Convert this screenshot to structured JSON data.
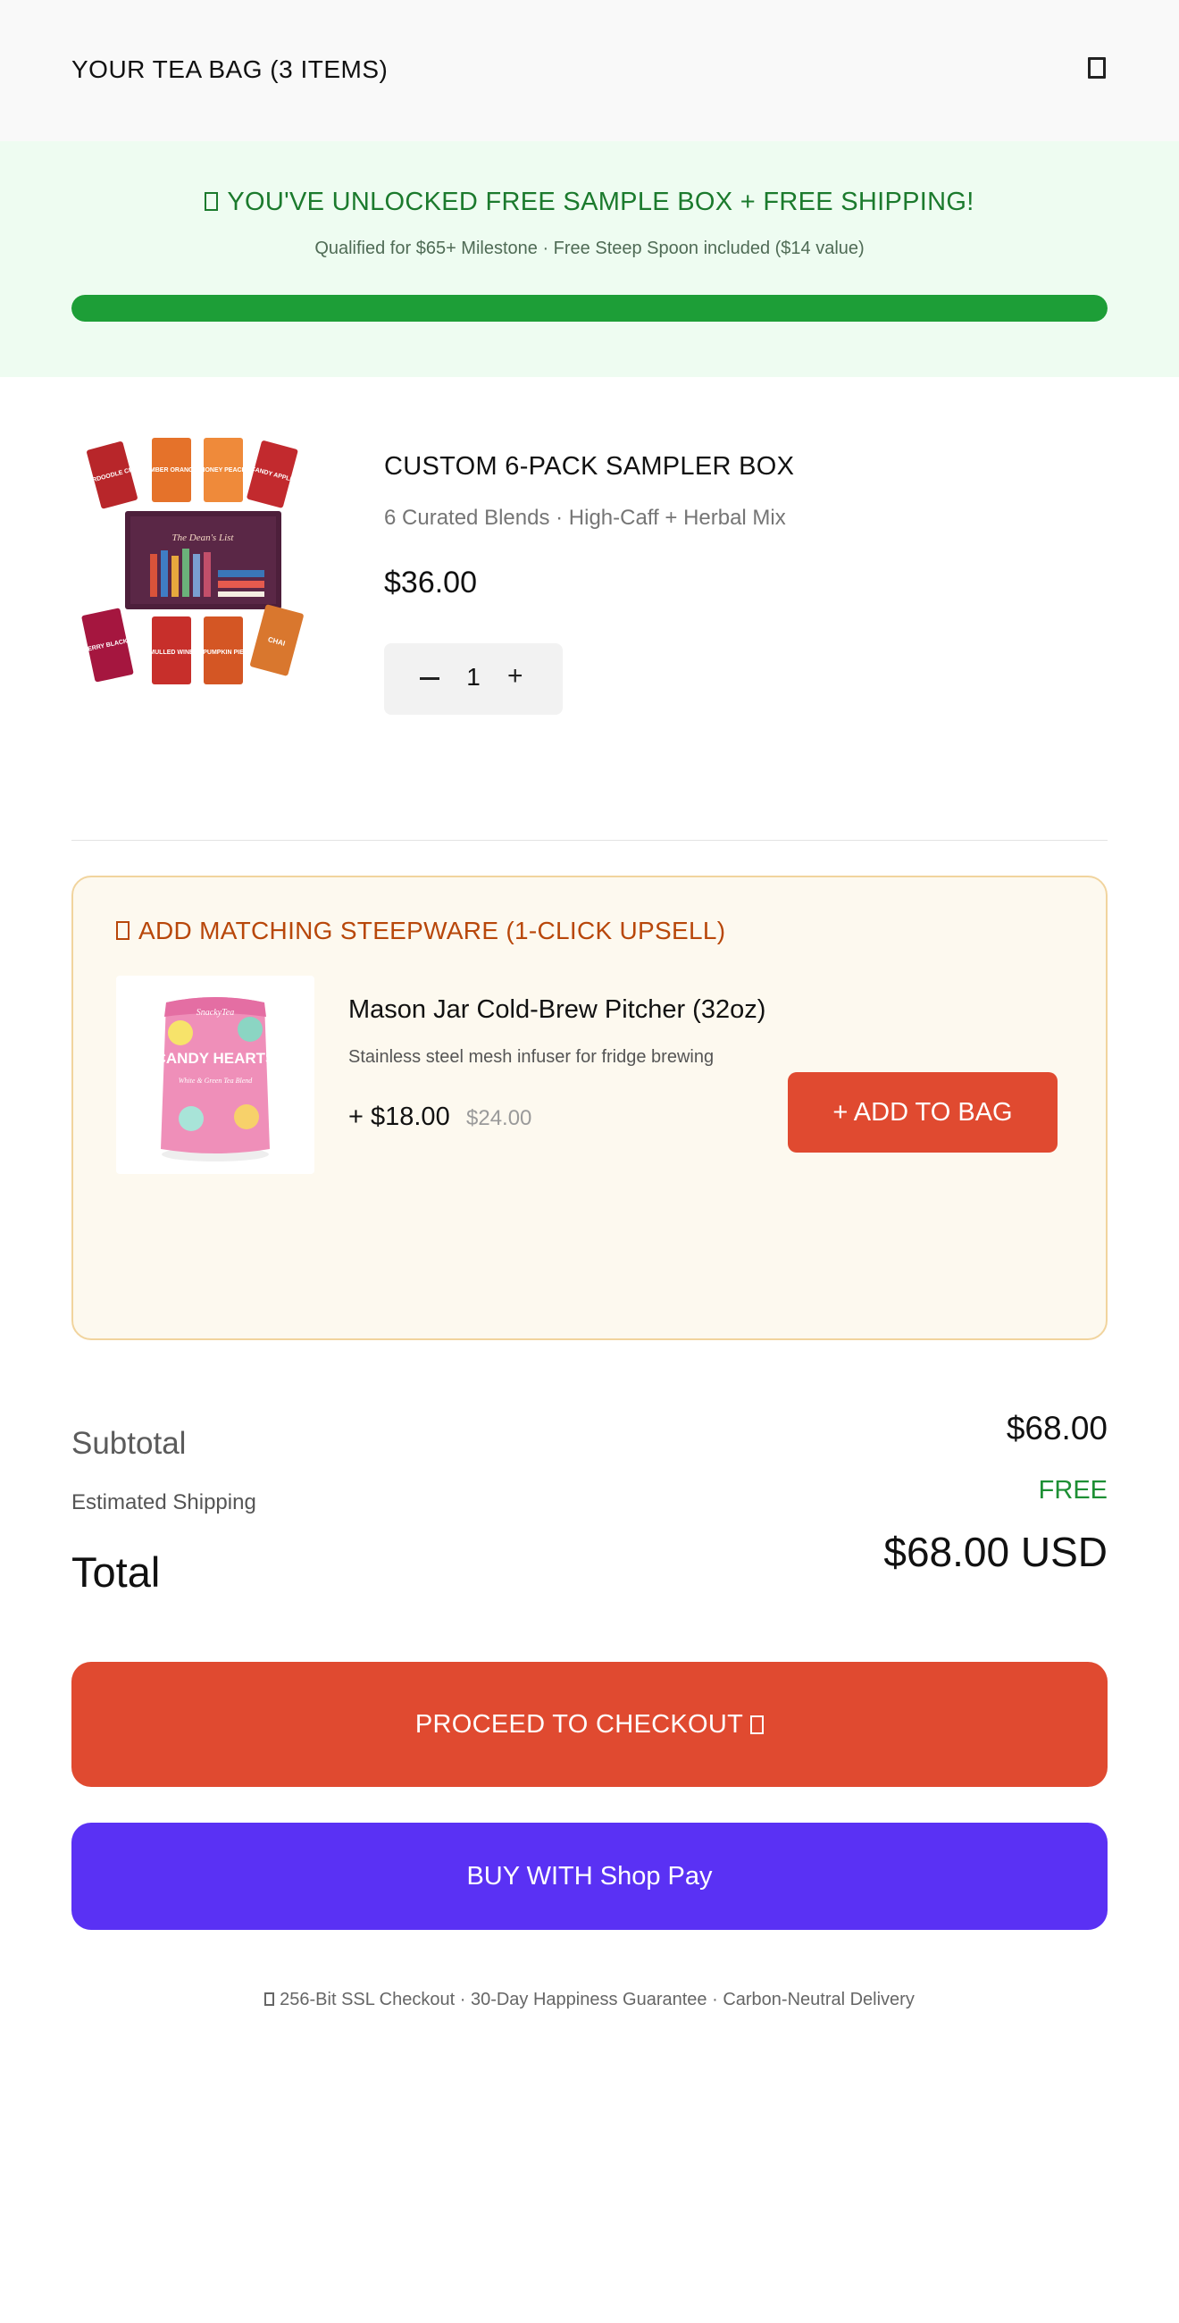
{
  "header": {
    "title": "YOUR TEA BAG (3 ITEMS)",
    "close_icon": "close-icon"
  },
  "promo": {
    "icon": "gift-icon",
    "title": "YOU'VE UNLOCKED FREE SAMPLE BOX + FREE SHIPPING!",
    "subtitle": "Qualified for $65+ Milestone · Free Steep Spoon included ($14 value)",
    "progress_percent": 100,
    "colors": {
      "background": "#eefcf1",
      "text": "#1b7a2d",
      "bar": "#1d9e37"
    }
  },
  "cart_item": {
    "name": "CUSTOM 6-PACK SAMPLER BOX",
    "description": "6 Curated Blends · High-Caff + Herbal Mix",
    "price": "$36.00",
    "quantity": "1",
    "image": {
      "box_label": "The Dean's List",
      "pouches": [
        "SNICKERDOODLE CRUMBLE",
        "AMBER ORANGE",
        "HONEY PEACH",
        "CANDY APPLE",
        "RASPBERRY BLACKBERRY",
        "MULLED WINE",
        "PUMPKIN PIE",
        "CHAI"
      ]
    }
  },
  "upsell": {
    "icon": "sparkle-icon",
    "title": "ADD MATCHING STEEPWARE (1-CLICK UPSELL)",
    "name": "Mason Jar Cold-Brew Pitcher (32oz)",
    "description": "Stainless steel mesh infuser for fridge brewing",
    "price": "+ $18.00",
    "compare_price": "$24.00",
    "button_label": "+ ADD TO BAG",
    "image": {
      "brand": "SnackyTea",
      "product": "CANDY HEARTS",
      "tagline": "White & Green Tea Blend"
    }
  },
  "summary": {
    "subtotal_label": "Subtotal",
    "subtotal_value": "$68.00",
    "shipping_label": "Estimated Shipping",
    "shipping_value": "FREE",
    "total_label": "Total",
    "total_value": "$68.00 USD"
  },
  "buttons": {
    "checkout_label": "PROCEED TO CHECKOUT",
    "checkout_icon": "arrow-icon",
    "shoppay_label": "BUY WITH Shop Pay",
    "colors": {
      "checkout": "#e04a30",
      "shoppay": "#5a31f4"
    }
  },
  "trust": {
    "icon": "lock-icon",
    "text": "256-Bit SSL Checkout · 30-Day Happiness Guarantee · Carbon-Neutral Delivery"
  }
}
